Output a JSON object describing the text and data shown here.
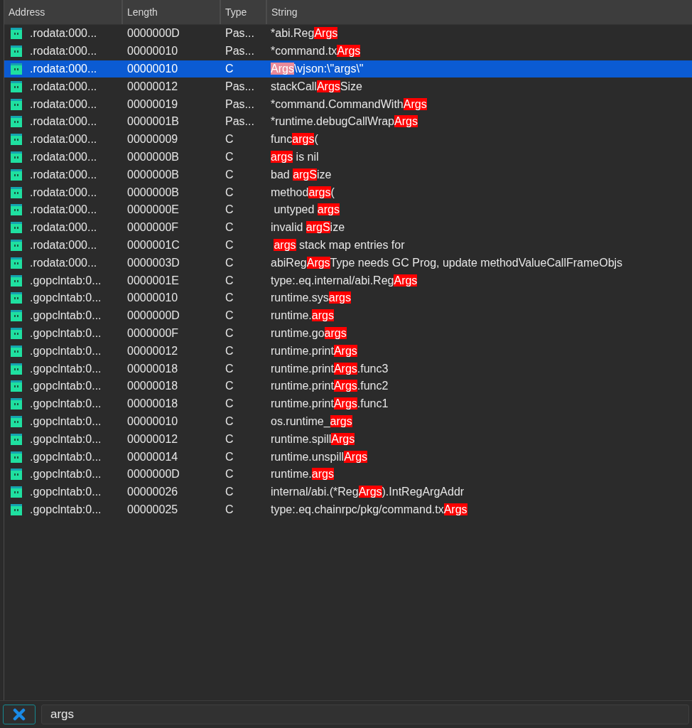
{
  "table": {
    "columns": [
      "Address",
      "Length",
      "Type",
      "String"
    ],
    "rows": [
      {
        "address": ".rodata:000...",
        "length": "0000000D",
        "type": "Pas...",
        "selected": false,
        "segments": [
          {
            "text": "*abi.Reg",
            "highlight": false
          },
          {
            "text": "Args",
            "highlight": true
          }
        ]
      },
      {
        "address": ".rodata:000...",
        "length": "00000010",
        "type": "Pas...",
        "selected": false,
        "segments": [
          {
            "text": "*command.tx",
            "highlight": false
          },
          {
            "text": "Args",
            "highlight": true
          }
        ]
      },
      {
        "address": ".rodata:000...",
        "length": "00000010",
        "type": "C",
        "selected": true,
        "segments": [
          {
            "text": "Args",
            "highlight": true
          },
          {
            "text": "\\vjson:\\\"args\\\"",
            "highlight": false
          }
        ]
      },
      {
        "address": ".rodata:000...",
        "length": "00000012",
        "type": "Pas...",
        "selected": false,
        "segments": [
          {
            "text": "stackCall",
            "highlight": false
          },
          {
            "text": "Args",
            "highlight": true
          },
          {
            "text": "Size",
            "highlight": false
          }
        ]
      },
      {
        "address": ".rodata:000...",
        "length": "00000019",
        "type": "Pas...",
        "selected": false,
        "segments": [
          {
            "text": "*command.CommandWith",
            "highlight": false
          },
          {
            "text": "Args",
            "highlight": true
          }
        ]
      },
      {
        "address": ".rodata:000...",
        "length": "0000001B",
        "type": "Pas...",
        "selected": false,
        "segments": [
          {
            "text": "*runtime.debugCallWrap",
            "highlight": false
          },
          {
            "text": "Args",
            "highlight": true
          }
        ]
      },
      {
        "address": ".rodata:000...",
        "length": "00000009",
        "type": "C",
        "selected": false,
        "segments": [
          {
            "text": "func",
            "highlight": false
          },
          {
            "text": "args",
            "highlight": true
          },
          {
            "text": "(",
            "highlight": false
          }
        ]
      },
      {
        "address": ".rodata:000...",
        "length": "0000000B",
        "type": "C",
        "selected": false,
        "segments": [
          {
            "text": "args",
            "highlight": true
          },
          {
            "text": " is nil",
            "highlight": false
          }
        ]
      },
      {
        "address": ".rodata:000...",
        "length": "0000000B",
        "type": "C",
        "selected": false,
        "segments": [
          {
            "text": "bad ",
            "highlight": false
          },
          {
            "text": "argS",
            "highlight": true
          },
          {
            "text": "ize",
            "highlight": false
          }
        ]
      },
      {
        "address": ".rodata:000...",
        "length": "0000000B",
        "type": "C",
        "selected": false,
        "segments": [
          {
            "text": "method",
            "highlight": false
          },
          {
            "text": "args",
            "highlight": true
          },
          {
            "text": "(",
            "highlight": false
          }
        ]
      },
      {
        "address": ".rodata:000...",
        "length": "0000000E",
        "type": "C",
        "selected": false,
        "segments": [
          {
            "text": " untyped ",
            "highlight": false
          },
          {
            "text": "args",
            "highlight": true
          }
        ]
      },
      {
        "address": ".rodata:000...",
        "length": "0000000F",
        "type": "C",
        "selected": false,
        "segments": [
          {
            "text": "invalid ",
            "highlight": false
          },
          {
            "text": "argS",
            "highlight": true
          },
          {
            "text": "ize",
            "highlight": false
          }
        ]
      },
      {
        "address": ".rodata:000...",
        "length": "0000001C",
        "type": "C",
        "selected": false,
        "segments": [
          {
            "text": "args",
            "highlight": true,
            "space_before": true
          },
          {
            "text": " stack map entries for",
            "highlight": false
          }
        ]
      },
      {
        "address": ".rodata:000...",
        "length": "0000003D",
        "type": "C",
        "selected": false,
        "segments": [
          {
            "text": "abiReg",
            "highlight": false
          },
          {
            "text": "Args",
            "highlight": true
          },
          {
            "text": "Type needs GC Prog, update methodValueCallFrameObjs",
            "highlight": false
          }
        ]
      },
      {
        "address": ".gopclntab:0...",
        "length": "0000001E",
        "type": "C",
        "selected": false,
        "segments": [
          {
            "text": "type:.eq.internal/abi.Reg",
            "highlight": false
          },
          {
            "text": "Args",
            "highlight": true
          }
        ]
      },
      {
        "address": ".gopclntab:0...",
        "length": "00000010",
        "type": "C",
        "selected": false,
        "segments": [
          {
            "text": "runtime.sys",
            "highlight": false
          },
          {
            "text": "args",
            "highlight": true
          }
        ]
      },
      {
        "address": ".gopclntab:0...",
        "length": "0000000D",
        "type": "C",
        "selected": false,
        "segments": [
          {
            "text": "runtime.",
            "highlight": false
          },
          {
            "text": "args",
            "highlight": true
          }
        ]
      },
      {
        "address": ".gopclntab:0...",
        "length": "0000000F",
        "type": "C",
        "selected": false,
        "segments": [
          {
            "text": "runtime.go",
            "highlight": false
          },
          {
            "text": "args",
            "highlight": true
          }
        ]
      },
      {
        "address": ".gopclntab:0...",
        "length": "00000012",
        "type": "C",
        "selected": false,
        "segments": [
          {
            "text": "runtime.print",
            "highlight": false
          },
          {
            "text": "Args",
            "highlight": true
          }
        ]
      },
      {
        "address": ".gopclntab:0...",
        "length": "00000018",
        "type": "C",
        "selected": false,
        "segments": [
          {
            "text": "runtime.print",
            "highlight": false
          },
          {
            "text": "Args",
            "highlight": true
          },
          {
            "text": ".func3",
            "highlight": false
          }
        ]
      },
      {
        "address": ".gopclntab:0...",
        "length": "00000018",
        "type": "C",
        "selected": false,
        "segments": [
          {
            "text": "runtime.print",
            "highlight": false
          },
          {
            "text": "Args",
            "highlight": true
          },
          {
            "text": ".func2",
            "highlight": false
          }
        ]
      },
      {
        "address": ".gopclntab:0...",
        "length": "00000018",
        "type": "C",
        "selected": false,
        "segments": [
          {
            "text": "runtime.print",
            "highlight": false
          },
          {
            "text": "Args",
            "highlight": true
          },
          {
            "text": ".func1",
            "highlight": false
          }
        ]
      },
      {
        "address": ".gopclntab:0...",
        "length": "00000010",
        "type": "C",
        "selected": false,
        "segments": [
          {
            "text": "os.runtime_",
            "highlight": false
          },
          {
            "text": "args",
            "highlight": true
          }
        ]
      },
      {
        "address": ".gopclntab:0...",
        "length": "00000012",
        "type": "C",
        "selected": false,
        "segments": [
          {
            "text": "runtime.spill",
            "highlight": false
          },
          {
            "text": "Args",
            "highlight": true
          }
        ]
      },
      {
        "address": ".gopclntab:0...",
        "length": "00000014",
        "type": "C",
        "selected": false,
        "segments": [
          {
            "text": "runtime.unspill",
            "highlight": false
          },
          {
            "text": "Args",
            "highlight": true
          }
        ]
      },
      {
        "address": ".gopclntab:0...",
        "length": "0000000D",
        "type": "C",
        "selected": false,
        "segments": [
          {
            "text": "runtime.",
            "highlight": false
          },
          {
            "text": "args",
            "highlight": true
          }
        ]
      },
      {
        "address": ".gopclntab:0...",
        "length": "00000026",
        "type": "C",
        "selected": false,
        "segments": [
          {
            "text": "internal/abi.(*Reg",
            "highlight": false
          },
          {
            "text": "Args",
            "highlight": true
          },
          {
            "text": ").IntRegArgAddr",
            "highlight": false
          }
        ]
      },
      {
        "address": ".gopclntab:0...",
        "length": "00000025",
        "type": "C",
        "selected": false,
        "segments": [
          {
            "text": "type:.eq.chainrpc/pkg/command.tx",
            "highlight": false
          },
          {
            "text": "Args",
            "highlight": true
          }
        ]
      }
    ]
  },
  "filter": {
    "value": "args"
  }
}
